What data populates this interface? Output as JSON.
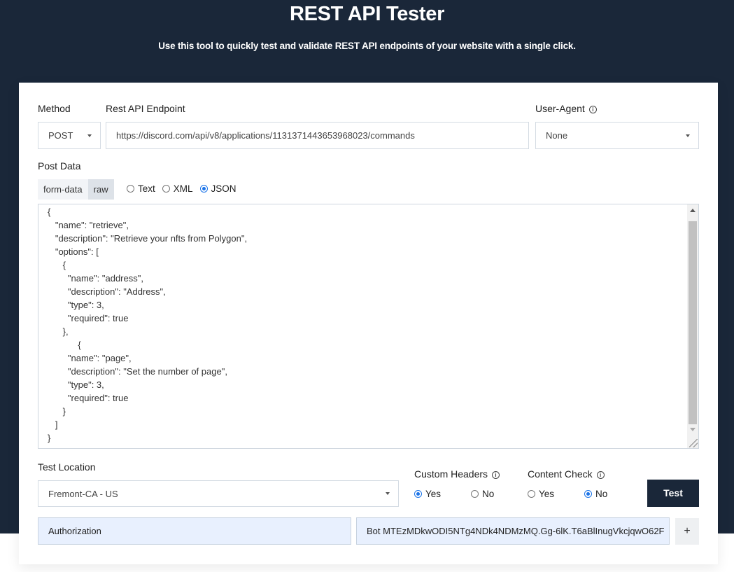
{
  "hero": {
    "title": "REST API Tester",
    "subtitle": "Use this tool to quickly test and validate REST API endpoints of your website with a single click."
  },
  "method": {
    "label": "Method",
    "value": "POST"
  },
  "endpoint": {
    "label": "Rest API Endpoint",
    "value": "https://discord.com/api/v8/applications/1131371443653968023/commands"
  },
  "user_agent": {
    "label": "User-Agent",
    "value": "None"
  },
  "post_data": {
    "label": "Post Data",
    "tabs": [
      {
        "label": "form-data",
        "active": false
      },
      {
        "label": "raw",
        "active": true
      }
    ],
    "formats": [
      {
        "label": "Text",
        "selected": false
      },
      {
        "label": "XML",
        "selected": false
      },
      {
        "label": "JSON",
        "selected": true
      }
    ],
    "body": "{\n   \"name\": \"retrieve\",\n   \"description\": \"Retrieve your nfts from Polygon\",\n   \"options\": [\n      {\n        \"name\": \"address\",\n        \"description\": \"Address\",\n        \"type\": 3,\n        \"required\": true\n      },\n            {\n        \"name\": \"page\",\n        \"description\": \"Set the number of page\",\n        \"type\": 3,\n        \"required\": true\n      }\n   ]\n}"
  },
  "test_location": {
    "label": "Test Location",
    "value": "Fremont-CA - US"
  },
  "custom_headers": {
    "label": "Custom Headers",
    "options": [
      {
        "label": "Yes",
        "selected": true
      },
      {
        "label": "No",
        "selected": false
      }
    ]
  },
  "content_check": {
    "label": "Content Check",
    "options": [
      {
        "label": "Yes",
        "selected": false
      },
      {
        "label": "No",
        "selected": true
      }
    ]
  },
  "test_button": "Test",
  "header_row": {
    "name": "Authorization",
    "value": "Bot MTEzMDkwODI5NTg4NDk4NDMzMQ.Gg-6lK.T6aBlInugVkcjqwO62F",
    "add_label": "+"
  },
  "icons": {
    "info": "ⓘ"
  },
  "colors": {
    "hero_bg": "#1a2739",
    "accent": "#1a73e8",
    "header_field_bg": "#e8f0fe"
  }
}
